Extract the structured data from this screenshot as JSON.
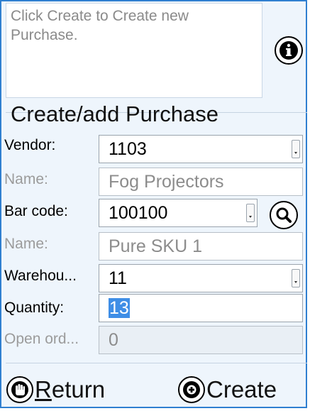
{
  "message": "Click Create to Create new Purchase.",
  "title": "Create/add Purchase",
  "fields": {
    "vendor": {
      "label": "Vendor:",
      "value": "1103"
    },
    "vendor_name": {
      "label": "Name:",
      "value": "Fog Projectors"
    },
    "bar_code": {
      "label": "Bar code:",
      "value": "100100"
    },
    "item_name": {
      "label": "Name:",
      "value": "Pure SKU 1"
    },
    "warehouse": {
      "label": "Warehou...",
      "value": "11"
    },
    "quantity": {
      "label": "Quantity:",
      "value": "13"
    },
    "open_orders": {
      "label": "Open ord...",
      "value": "0"
    }
  },
  "buttons": {
    "return_label": "Return",
    "create_label": "Create"
  },
  "icons": {
    "info": "info-icon",
    "search": "search-icon",
    "return": "hand-stop-icon",
    "create": "plus-circle-icon"
  },
  "colors": {
    "background": "#eef5fc",
    "border": "#2f7fd0",
    "selection": "#3f8ee6",
    "hint_text": "#8a8a8a"
  }
}
